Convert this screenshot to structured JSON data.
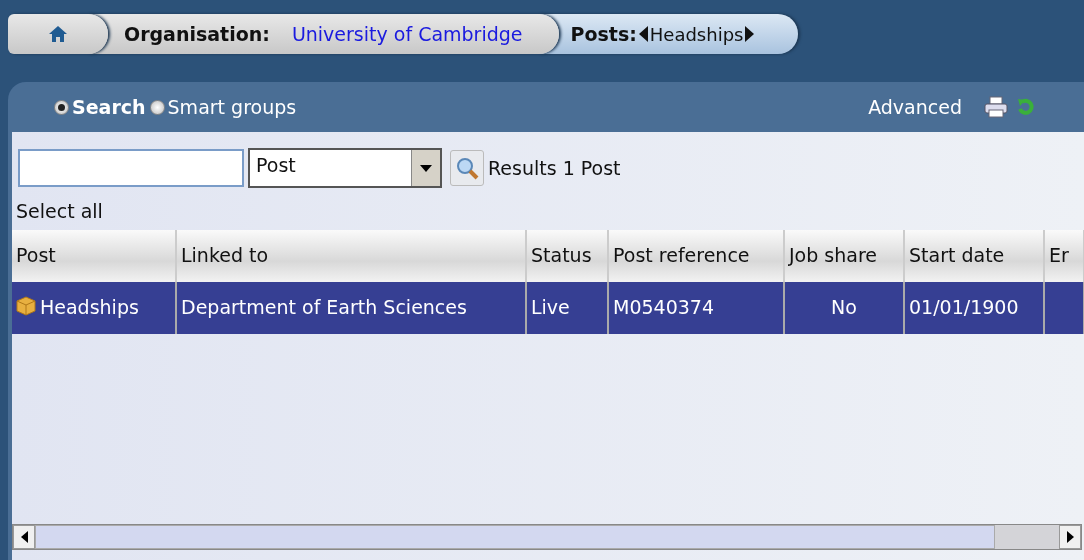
{
  "breadcrumb": {
    "organisation_label": "Organisation:",
    "organisation_value": "University of Cambridge",
    "posts_label": "Posts:",
    "posts_value": "Headships"
  },
  "modes": [
    {
      "label": "Search",
      "selected": true
    },
    {
      "label": "Smart groups",
      "selected": false
    }
  ],
  "advanced_link": "Advanced",
  "search": {
    "type_select": "Post",
    "results": "Results 1 Post",
    "select_all": "Select all"
  },
  "table": {
    "columns": [
      "Post",
      "Linked to",
      "Status",
      "Post reference",
      "Job share",
      "Start date",
      "Er"
    ],
    "rows": [
      {
        "selected": true,
        "cells": [
          "Headships",
          "Department of Earth Sciences",
          "Live",
          "M0540374",
          "No",
          "01/01/1900"
        ]
      }
    ]
  }
}
